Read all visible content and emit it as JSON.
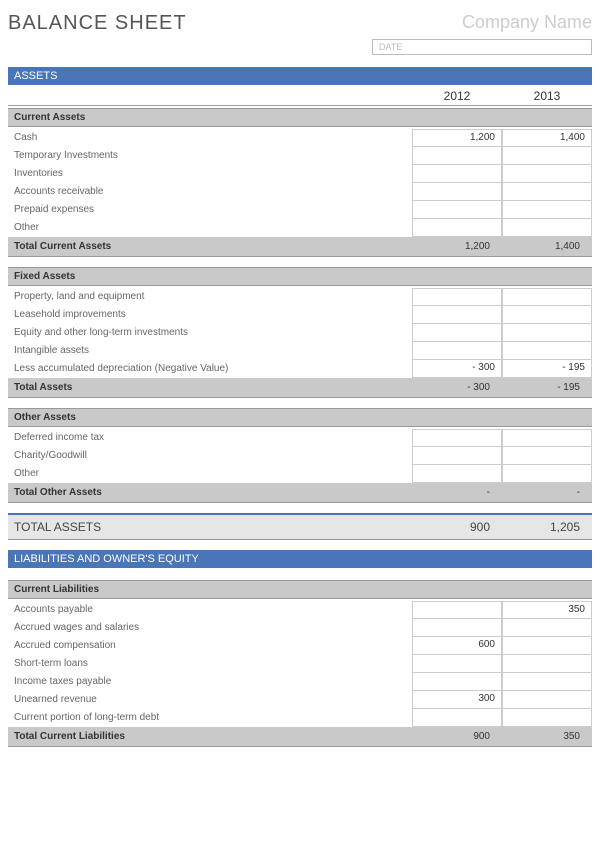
{
  "header": {
    "title": "BALANCE SHEET",
    "company": "Company Name",
    "date_placeholder": "DATE"
  },
  "years": {
    "y1": "2012",
    "y2": "2013"
  },
  "assets": {
    "section_title": "ASSETS",
    "current": {
      "header": "Current Assets",
      "rows": [
        {
          "label": "Cash",
          "v1": "1,200",
          "v2": "1,400"
        },
        {
          "label": "Temporary Investments",
          "v1": "",
          "v2": ""
        },
        {
          "label": "Inventories",
          "v1": "",
          "v2": ""
        },
        {
          "label": "Accounts receivable",
          "v1": "",
          "v2": ""
        },
        {
          "label": "Prepaid expenses",
          "v1": "",
          "v2": ""
        },
        {
          "label": "Other",
          "v1": "",
          "v2": ""
        }
      ],
      "total": {
        "label": "Total Current Assets",
        "v1": "1,200",
        "v2": "1,400"
      }
    },
    "fixed": {
      "header": "Fixed Assets",
      "rows": [
        {
          "label": "Property, land and equipment",
          "v1": "",
          "v2": ""
        },
        {
          "label": "Leasehold improvements",
          "v1": "",
          "v2": ""
        },
        {
          "label": "Equity and other long-term investments",
          "v1": "",
          "v2": ""
        },
        {
          "label": "Intangible assets",
          "v1": "",
          "v2": ""
        },
        {
          "label": "Less accumulated depreciation (Negative Value)",
          "v1": "- 300",
          "v2": "- 195"
        }
      ],
      "total": {
        "label": "Total Assets",
        "v1": "- 300",
        "v2": "- 195"
      }
    },
    "other": {
      "header": "Other Assets",
      "rows": [
        {
          "label": "Deferred income tax",
          "v1": "",
          "v2": ""
        },
        {
          "label": "Charity/Goodwill",
          "v1": "",
          "v2": ""
        },
        {
          "label": "Other",
          "v1": "",
          "v2": ""
        }
      ],
      "total": {
        "label": "Total Other Assets",
        "v1": "-",
        "v2": "-"
      }
    },
    "grand_total": {
      "label": "TOTAL ASSETS",
      "v1": "900",
      "v2": "1,205"
    }
  },
  "liabilities": {
    "section_title": "LIABILITIES AND OWNER'S EQUITY",
    "current": {
      "header": "Current Liabilities",
      "rows": [
        {
          "label": "Accounts payable",
          "v1": "",
          "v2": "350"
        },
        {
          "label": "Accrued wages and salaries",
          "v1": "",
          "v2": ""
        },
        {
          "label": "Accrued compensation",
          "v1": "600",
          "v2": ""
        },
        {
          "label": "Short-term loans",
          "v1": "",
          "v2": ""
        },
        {
          "label": "Income taxes payable",
          "v1": "",
          "v2": ""
        },
        {
          "label": "Unearned revenue",
          "v1": "300",
          "v2": ""
        },
        {
          "label": "Current portion of long-term debt",
          "v1": "",
          "v2": ""
        }
      ],
      "total": {
        "label": "Total Current Liabilities",
        "v1": "900",
        "v2": "350"
      }
    }
  }
}
